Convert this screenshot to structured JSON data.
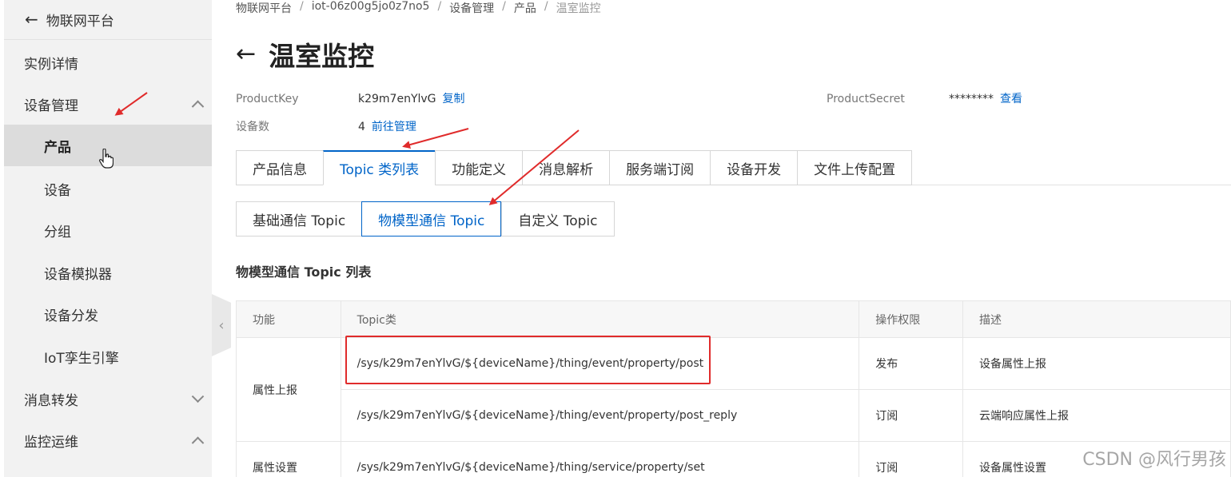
{
  "sidebar": {
    "header": "物联网平台",
    "items": [
      {
        "label": "实例详情",
        "level": 1
      },
      {
        "label": "设备管理",
        "level": 1,
        "chevron": "up"
      },
      {
        "label": "产品",
        "level": 2,
        "active": true
      },
      {
        "label": "设备",
        "level": 2
      },
      {
        "label": "分组",
        "level": 2
      },
      {
        "label": "设备模拟器",
        "level": 2
      },
      {
        "label": "设备分发",
        "level": 2
      },
      {
        "label": "IoT孪生引擎",
        "level": 2
      },
      {
        "label": "消息转发",
        "level": 1,
        "chevron": "down"
      },
      {
        "label": "监控运维",
        "level": 1,
        "chevron": "up"
      }
    ]
  },
  "breadcrumb": [
    "物联网平台",
    "iot-06z00g5jo0z7no5",
    "设备管理",
    "产品",
    "温室监控"
  ],
  "page_title": "温室监控",
  "info": {
    "product_key_label": "ProductKey",
    "product_key_value": "k29m7enYlvG",
    "copy_link": "复制",
    "device_count_label": "设备数",
    "device_count_value": "4",
    "manage_link": "前往管理",
    "product_secret_label": "ProductSecret",
    "product_secret_value": "********",
    "view_link": "查看"
  },
  "tabs": [
    "产品信息",
    "Topic 类列表",
    "功能定义",
    "消息解析",
    "服务端订阅",
    "设备开发",
    "文件上传配置"
  ],
  "subtabs": [
    "基础通信 Topic",
    "物模型通信 Topic",
    "自定义 Topic"
  ],
  "section_title": "物模型通信 Topic 列表",
  "table": {
    "headers": [
      "功能",
      "Topic类",
      "操作权限",
      "描述"
    ],
    "groups": [
      {
        "function": "属性上报",
        "rows": [
          {
            "topic": "/sys/k29m7enYlvG/${deviceName}/thing/event/property/post",
            "permission": "发布",
            "description": "设备属性上报"
          },
          {
            "topic": "/sys/k29m7enYlvG/${deviceName}/thing/event/property/post_reply",
            "permission": "订阅",
            "description": "云端响应属性上报"
          }
        ]
      },
      {
        "function": "属性设置",
        "rows": [
          {
            "topic": "/sys/k29m7enYlvG/${deviceName}/thing/service/property/set",
            "permission": "订阅",
            "description": "设备属性设置"
          }
        ]
      }
    ]
  },
  "watermark": "CSDN @风行男孩",
  "colors": {
    "accent": "#0064c8",
    "annotation_red": "#e02b2b"
  }
}
